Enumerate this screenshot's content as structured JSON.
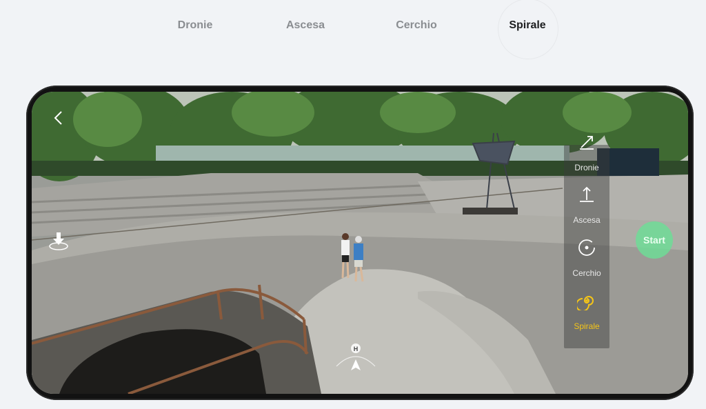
{
  "tabs": [
    {
      "label": "Dronie",
      "active": false
    },
    {
      "label": "Ascesa",
      "active": false
    },
    {
      "label": "Cerchio",
      "active": false
    },
    {
      "label": "Spirale",
      "active": true
    }
  ],
  "modes": [
    {
      "label": "Dronie",
      "icon": "dronie-icon",
      "active": false
    },
    {
      "label": "Ascesa",
      "icon": "ascend-icon",
      "active": false
    },
    {
      "label": "Cerchio",
      "icon": "circle-orbit-icon",
      "active": false
    },
    {
      "label": "Spirale",
      "icon": "spiral-icon",
      "active": true
    }
  ],
  "start_label": "Start",
  "compass_label": "H",
  "colors": {
    "active_mode": "#f5c518",
    "start": "#6edc96",
    "tab_active": "#1d1e20",
    "tab_inactive": "#8a8d91"
  }
}
